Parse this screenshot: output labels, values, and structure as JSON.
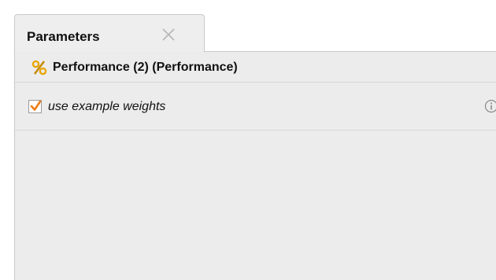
{
  "tab": {
    "title": "Parameters",
    "close_icon": "close-icon"
  },
  "operator": {
    "icon": "percent-icon",
    "title": "Performance (2) (Performance)"
  },
  "parameters": [
    {
      "label": "use example weights",
      "checked": true,
      "icon": "info-icon"
    }
  ],
  "colors": {
    "checkmark": "#f07d1a",
    "operator_icon": "#e8a600"
  }
}
